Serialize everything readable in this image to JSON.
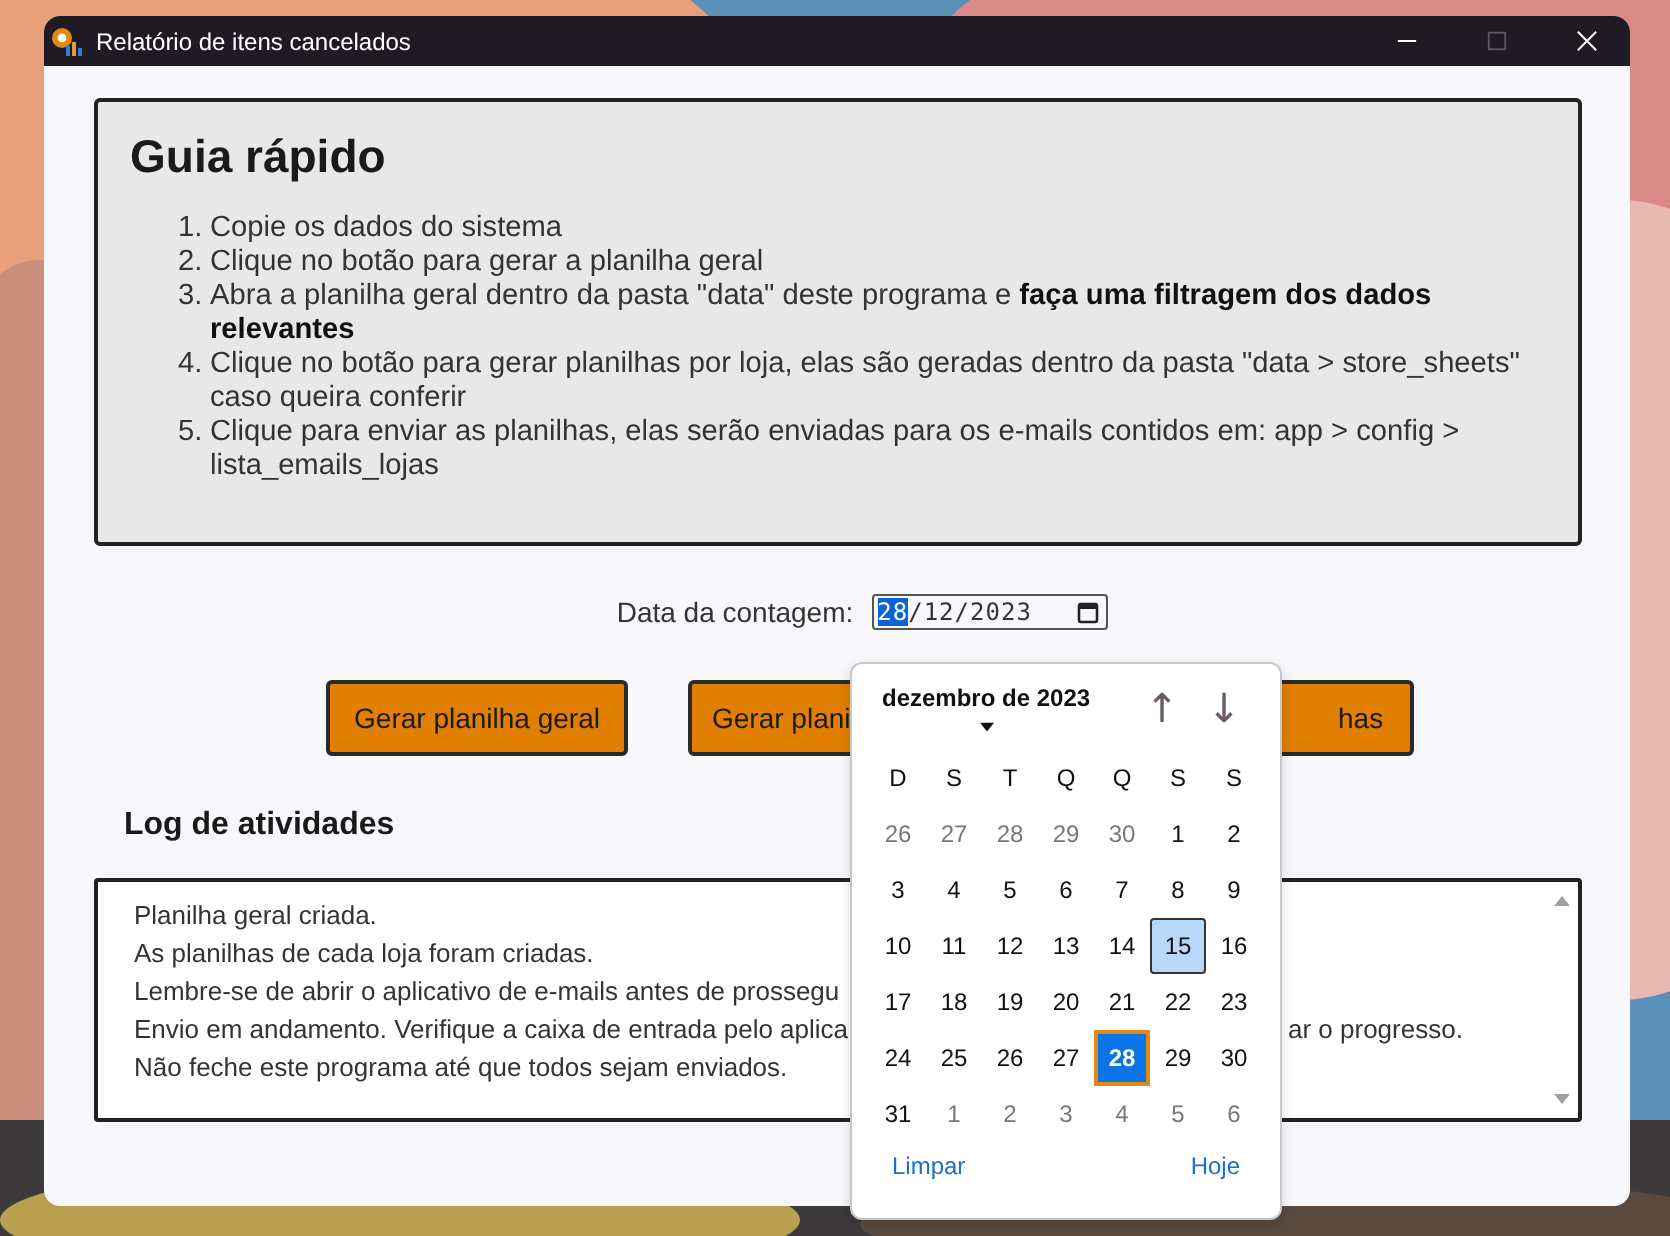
{
  "window": {
    "title": "Relatório de itens cancelados"
  },
  "guide": {
    "title": "Guia rápido",
    "steps": [
      {
        "marker": "1.",
        "text": "Copie os dados do sistema"
      },
      {
        "marker": "2.",
        "text": "Clique no botão para gerar a planilha geral"
      },
      {
        "marker": "3.",
        "text": "Abra a planilha geral dentro da pasta \"data\" deste programa e **faça uma filtragem dos dados relevantes**"
      },
      {
        "marker": "4.",
        "text": "Clique no botão para gerar planilhas por loja, elas são geradas dentro da pasta \"data > store_sheets\" caso queira conferir"
      },
      {
        "marker": "5.",
        "text": "Clique para enviar as planilhas, elas serão enviadas para os e-mails contidos em: app > config > lista_emails_lojas"
      }
    ]
  },
  "date_field": {
    "label": "Data da contagem:",
    "segments": [
      {
        "text": "28",
        "selected": true
      },
      {
        "text": "/",
        "selected": false
      },
      {
        "text": "12",
        "selected": false
      },
      {
        "text": "/",
        "selected": false
      },
      {
        "text": "2023",
        "selected": false
      }
    ]
  },
  "buttons": [
    {
      "label": "Gerar planilha geral"
    },
    {
      "label": "Gerar plani"
    },
    {
      "label": "has"
    }
  ],
  "log": {
    "title": "Log de atividades",
    "lines": [
      {
        "text": "Planilha geral criada."
      },
      {
        "text": "As planilhas de cada loja foram criadas."
      },
      {
        "text": "Lembre-se de abrir o aplicativo de e-mails antes de prossegu"
      },
      {
        "text": "Envio em andamento. Verifique a caixa de entrada pelo aplica",
        "tail": "ar o progresso."
      },
      {
        "text": "Não feche este programa até que todos sejam enviados."
      }
    ]
  },
  "calendar": {
    "month": "dezembro de 2023",
    "up": "↑",
    "down": "↓",
    "weekdays": [
      "D",
      "S",
      "T",
      "Q",
      "Q",
      "S",
      "S"
    ],
    "weeks": [
      [
        {
          "day": "26",
          "outside": true,
          "selected": false,
          "hover": false
        },
        {
          "day": "27",
          "outside": true,
          "selected": false,
          "hover": false
        },
        {
          "day": "28",
          "outside": true,
          "selected": false,
          "hover": false
        },
        {
          "day": "29",
          "outside": true,
          "selected": false,
          "hover": false
        },
        {
          "day": "30",
          "outside": true,
          "selected": false,
          "hover": false
        },
        {
          "day": "1",
          "outside": false,
          "selected": false,
          "hover": false
        },
        {
          "day": "2",
          "outside": false,
          "selected": false,
          "hover": false
        }
      ],
      [
        {
          "day": "3",
          "outside": false,
          "selected": false,
          "hover": false
        },
        {
          "day": "4",
          "outside": false,
          "selected": false,
          "hover": false
        },
        {
          "day": "5",
          "outside": false,
          "selected": false,
          "hover": false
        },
        {
          "day": "6",
          "outside": false,
          "selected": false,
          "hover": false
        },
        {
          "day": "7",
          "outside": false,
          "selected": false,
          "hover": false
        },
        {
          "day": "8",
          "outside": false,
          "selected": false,
          "hover": false
        },
        {
          "day": "9",
          "outside": false,
          "selected": false,
          "hover": false
        }
      ],
      [
        {
          "day": "10",
          "outside": false,
          "selected": false,
          "hover": false
        },
        {
          "day": "11",
          "outside": false,
          "selected": false,
          "hover": false
        },
        {
          "day": "12",
          "outside": false,
          "selected": false,
          "hover": false
        },
        {
          "day": "13",
          "outside": false,
          "selected": false,
          "hover": false
        },
        {
          "day": "14",
          "outside": false,
          "selected": false,
          "hover": false
        },
        {
          "day": "15",
          "outside": false,
          "selected": false,
          "hover": true
        },
        {
          "day": "16",
          "outside": false,
          "selected": false,
          "hover": false
        }
      ],
      [
        {
          "day": "17",
          "outside": false,
          "selected": false,
          "hover": false
        },
        {
          "day": "18",
          "outside": false,
          "selected": false,
          "hover": false
        },
        {
          "day": "19",
          "outside": false,
          "selected": false,
          "hover": false
        },
        {
          "day": "20",
          "outside": false,
          "selected": false,
          "hover": false
        },
        {
          "day": "21",
          "outside": false,
          "selected": false,
          "hover": false
        },
        {
          "day": "22",
          "outside": false,
          "selected": false,
          "hover": false
        },
        {
          "day": "23",
          "outside": false,
          "selected": false,
          "hover": false
        }
      ],
      [
        {
          "day": "24",
          "outside": false,
          "selected": false,
          "hover": false
        },
        {
          "day": "25",
          "outside": false,
          "selected": false,
          "hover": false
        },
        {
          "day": "26",
          "outside": false,
          "selected": false,
          "hover": false
        },
        {
          "day": "27",
          "outside": false,
          "selected": false,
          "hover": false
        },
        {
          "day": "28",
          "outside": false,
          "selected": true,
          "hover": false
        },
        {
          "day": "29",
          "outside": false,
          "selected": false,
          "hover": false
        },
        {
          "day": "30",
          "outside": false,
          "selected": false,
          "hover": false
        }
      ],
      [
        {
          "day": "31",
          "outside": false,
          "selected": false,
          "hover": false
        },
        {
          "day": "1",
          "outside": true,
          "selected": false,
          "hover": false
        },
        {
          "day": "2",
          "outside": true,
          "selected": false,
          "hover": false
        },
        {
          "day": "3",
          "outside": true,
          "selected": false,
          "hover": false
        },
        {
          "day": "4",
          "outside": true,
          "selected": false,
          "hover": false
        },
        {
          "day": "5",
          "outside": true,
          "selected": false,
          "hover": false
        },
        {
          "day": "6",
          "outside": true,
          "selected": false,
          "hover": false
        }
      ]
    ],
    "clear": "Limpar",
    "today": "Hoje"
  }
}
